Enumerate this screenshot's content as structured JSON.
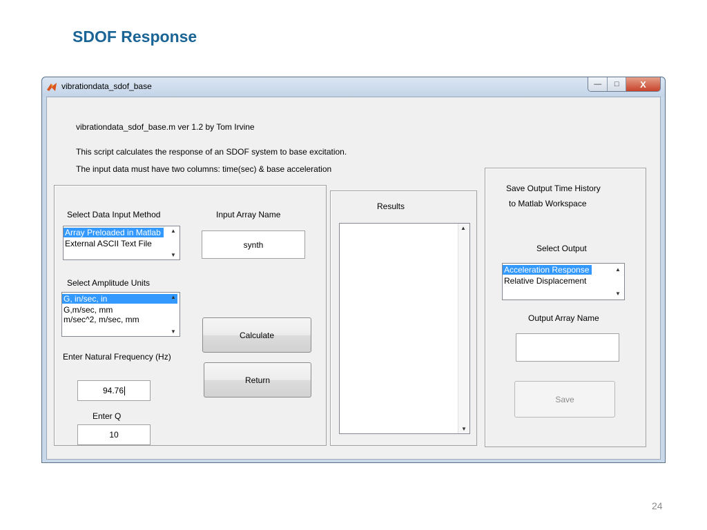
{
  "slide": {
    "title": "SDOF Response",
    "page_number": "24"
  },
  "window": {
    "title": "vibrationdata_sdof_base",
    "controls": {
      "minimize": "—",
      "maximize": "□",
      "close": "X"
    }
  },
  "header": {
    "line1": "vibrationdata_sdof_base.m  ver 1.2  by Tom Irvine",
    "line2": "This script calculates the response of an SDOF system to base excitation.",
    "line3": "The input data must have two columns:  time(sec) & base acceleration"
  },
  "input_panel": {
    "data_input_label": "Select Data Input Method",
    "data_input_options": [
      "Array Preloaded in Matlab",
      "External ASCII Text File"
    ],
    "array_name_label": "Input Array Name",
    "array_name_value": "synth",
    "amplitude_label": "Select Amplitude Units",
    "amplitude_options": [
      "G, in/sec, in",
      "G,m/sec, mm",
      "m/sec^2, m/sec, mm"
    ],
    "freq_label": "Enter Natural Frequency (Hz)",
    "freq_value": "94.76",
    "q_label": "Enter Q",
    "q_value": "10",
    "calculate_label": "Calculate",
    "return_label": "Return"
  },
  "results_panel": {
    "label": "Results"
  },
  "output_panel": {
    "save_label_line1": "Save Output Time History",
    "save_label_line2": "to Matlab Workspace",
    "select_output_label": "Select Output",
    "output_options": [
      "Acceleration Response",
      "Relative Displacement"
    ],
    "output_array_name_label": "Output Array Name",
    "output_array_name_value": "",
    "save_button_label": "Save"
  },
  "colors": {
    "title_blue": "#1a6496",
    "selection_blue": "#3399ff"
  },
  "icons": {
    "app": "matlab-icon",
    "scroll_up": "scroll-up-arrow-icon",
    "scroll_down": "scroll-down-arrow-icon"
  }
}
